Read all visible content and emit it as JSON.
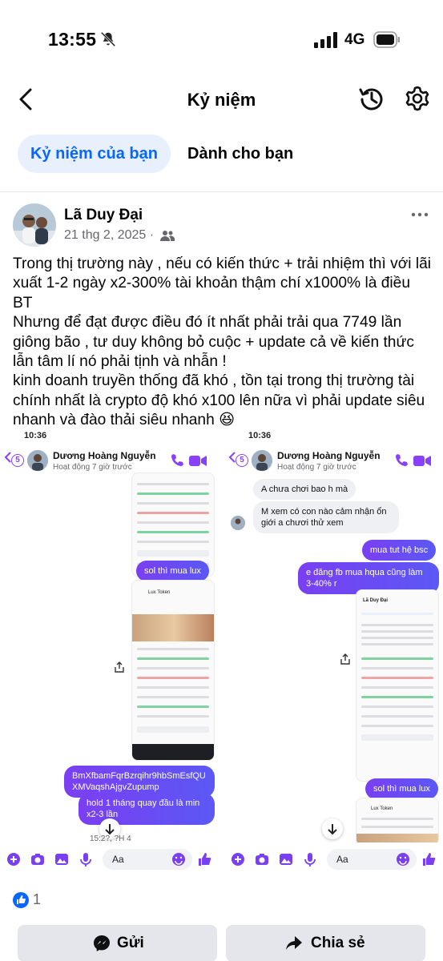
{
  "status_bar": {
    "time": "13:55",
    "network": "4G"
  },
  "header": {
    "title": "Kỷ niệm"
  },
  "tabs": [
    {
      "label": "Kỷ niệm của bạn",
      "active": true
    },
    {
      "label": "Dành cho bạn",
      "active": false
    }
  ],
  "post": {
    "author": "Lã Duy Đại",
    "date": "21 thg 2, 2025 ·",
    "text": "Trong thị trường này , nếu có kiến thức + trải nhiệm thì với lãi xuất 1-2 ngày x2-300% tài khoản thậm chí x1000% là điều BT\n Nhưng để đạt được điều đó ít nhất phải trải qua 7749 lần giông bão , tư duy không bỏ cuộc + update cả về kiến thức lẫn tâm lí nó phải tịnh và nhẫn !\nkinh doanh truyền thống đã khó , tồn tại trong thị trường tài chính nhất là crypto độ khó x100 lên nữa vì phải update siêu nhanh và đào thải siêu nhanh 😆",
    "reaction_count": "1"
  },
  "screenshots": {
    "left": {
      "clock": "10:36",
      "badge": "5",
      "contact": "Dương Hoàng Nguyễn",
      "activity": "Hoạt động 7 giờ trước",
      "messages": [
        "sol thì mua lux",
        "BmXfbamFqrBzrqihr9hbSmEsfQUXMVaqshAjgvZupump",
        "hold 1 tháng quay đầu là min x2-3 lần"
      ],
      "timestamp": "15:2?, ?H 4",
      "input_placeholder": "Aa",
      "token_name": "Lux Token"
    },
    "right": {
      "clock": "10:36",
      "badge": "5",
      "contact": "Dương Hoàng Nguyễn",
      "activity": "Hoạt động 7 giờ trước",
      "messages_in": [
        "A chưa chơi bao h mà",
        "M xem có con nào cảm nhận ổn giới a chươi thử xem"
      ],
      "messages_out": [
        "mua tut hệ bsc",
        "e đăng fb mua hqua cũng làm 3-40% r",
        "sol thì mua lux"
      ],
      "input_placeholder": "Aa",
      "profile_name": "Lã Duy Đại",
      "token_name": "Lux Token"
    }
  },
  "actions": {
    "send": "Gửi",
    "share": "Chia sẻ"
  },
  "colors": {
    "accent": "#0866ff",
    "messenger_purple": "#7a3ff2"
  }
}
